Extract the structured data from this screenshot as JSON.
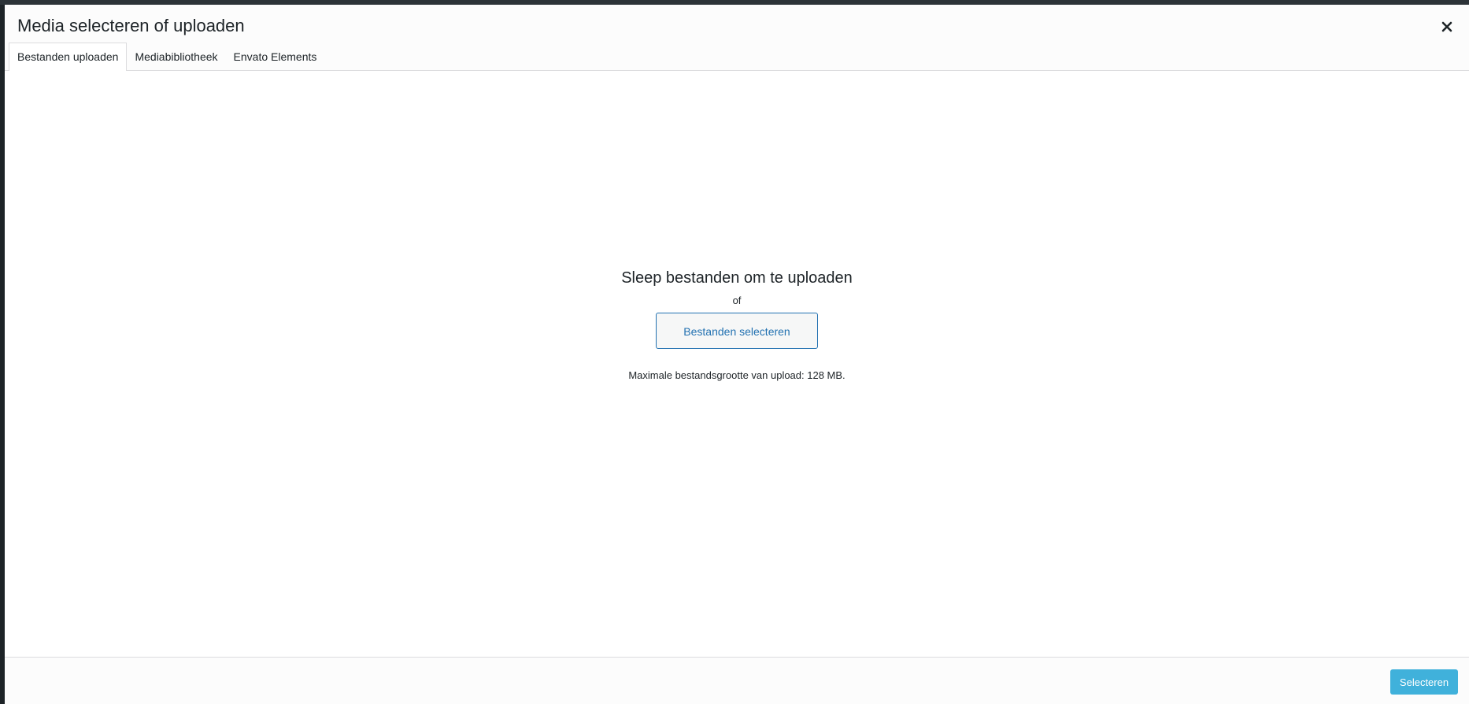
{
  "modal": {
    "title": "Media selecteren of uploaden",
    "close_icon": "close-icon"
  },
  "tabs": [
    {
      "label": "Bestanden uploaden",
      "active": true
    },
    {
      "label": "Mediabibliotheek",
      "active": false
    },
    {
      "label": "Envato Elements",
      "active": false
    }
  ],
  "upload": {
    "drop_text": "Sleep bestanden om te uploaden",
    "or_text": "of",
    "select_files_label": "Bestanden selecteren",
    "max_size_text": "Maximale bestandsgrootte van upload: 128 MB."
  },
  "footer": {
    "select_label": "Selecteren"
  },
  "colors": {
    "accent": "#2271b1",
    "primary_button": "#20a4d6",
    "backdrop": "#1d2327"
  }
}
